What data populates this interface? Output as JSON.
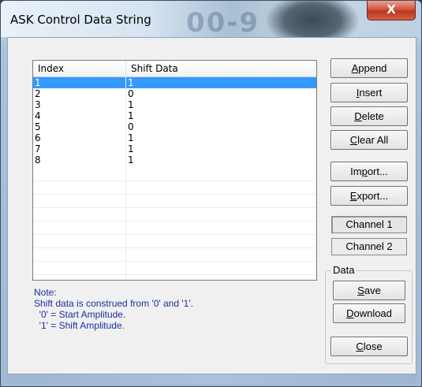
{
  "window": {
    "title": "ASK Control Data String",
    "close_glyph": "X"
  },
  "list": {
    "columns": [
      "Index",
      "Shift Data"
    ],
    "rows": [
      {
        "index": "1",
        "shift": "1",
        "selected": true
      },
      {
        "index": "2",
        "shift": "0"
      },
      {
        "index": "3",
        "shift": "1"
      },
      {
        "index": "4",
        "shift": "1"
      },
      {
        "index": "5",
        "shift": "0"
      },
      {
        "index": "6",
        "shift": "1"
      },
      {
        "index": "7",
        "shift": "1"
      },
      {
        "index": "8",
        "shift": "1"
      }
    ]
  },
  "note": {
    "lines": [
      "Note:",
      "Shift data is construed from '0' and '1'.",
      "  '0' = Start Amplitude.",
      "  '1' = Shift Amplitude."
    ]
  },
  "buttons": {
    "append": {
      "pre": "",
      "mn": "A",
      "post": "ppend"
    },
    "insert": {
      "pre": "",
      "mn": "I",
      "post": "nsert"
    },
    "delete": {
      "pre": "",
      "mn": "D",
      "post": "elete"
    },
    "clear_all": {
      "pre": "",
      "mn": "C",
      "post": "lear All"
    },
    "import": {
      "pre": "Im",
      "mn": "p",
      "post": "ort..."
    },
    "export": {
      "pre": "",
      "mn": "E",
      "post": "xport..."
    },
    "channel1": "Channel 1",
    "channel2": "Channel 2",
    "data_group": "Data",
    "save": {
      "pre": "",
      "mn": "S",
      "post": "ave"
    },
    "download": {
      "pre": "",
      "mn": "D",
      "post": "ownload"
    },
    "close": {
      "pre": "",
      "mn": "C",
      "post": "lose"
    }
  },
  "colors": {
    "selection": "#3399ff",
    "note_text": "#1a2f9e"
  }
}
